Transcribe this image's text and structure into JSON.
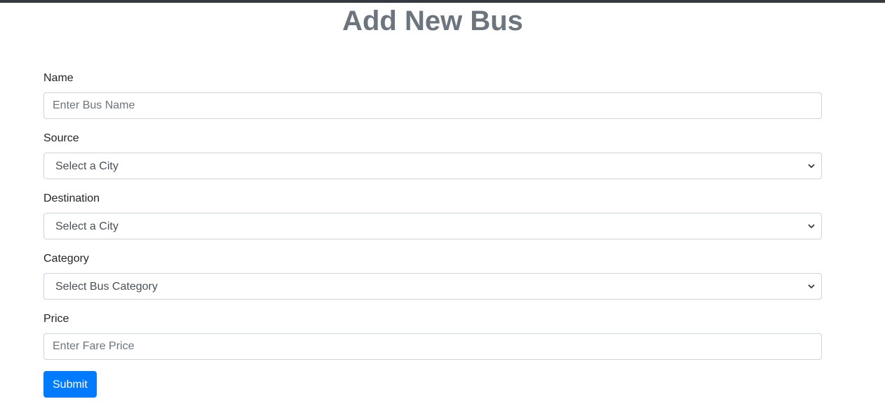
{
  "page": {
    "title": "Add New Bus"
  },
  "form": {
    "name": {
      "label": "Name",
      "placeholder": "Enter Bus Name",
      "value": ""
    },
    "source": {
      "label": "Source",
      "selected": "Select a City",
      "icon": "chevron-down-icon"
    },
    "destination": {
      "label": "Destination",
      "selected": "Select a City",
      "icon": "chevron-down-icon"
    },
    "category": {
      "label": "Category",
      "selected": "Select Bus Category",
      "icon": "chevron-down-icon"
    },
    "price": {
      "label": "Price",
      "placeholder": "Enter Fare Price",
      "value": ""
    },
    "submit_label": "Submit"
  },
  "colors": {
    "title": "#6c757d",
    "primary": "#007bff",
    "border": "#ced4da",
    "top_bar": "#343a40"
  }
}
